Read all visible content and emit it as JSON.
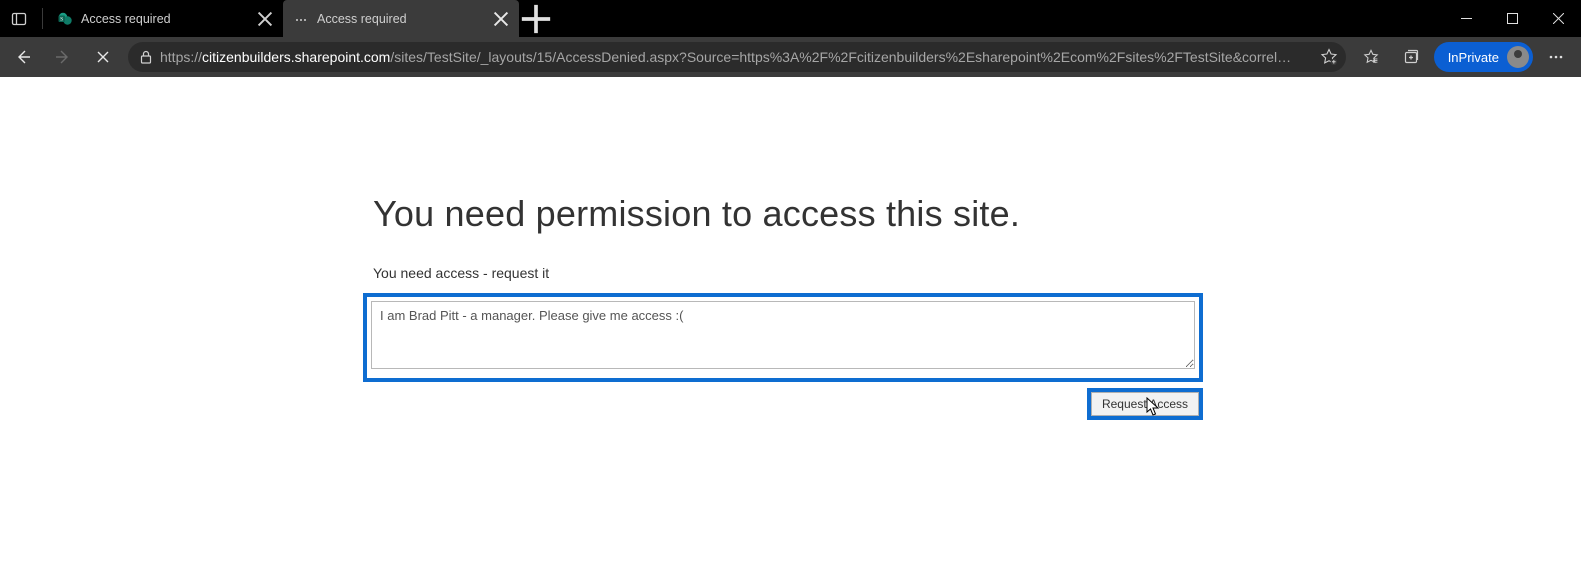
{
  "window": {
    "tabs": [
      {
        "title": "Access required",
        "favicon": "sharepoint",
        "active": false
      },
      {
        "title": "Access required",
        "favicon": "generic",
        "active": true
      }
    ],
    "url_protocol": "https://",
    "url_host": "citizenbuilders.sharepoint.com",
    "url_path": "/sites/TestSite/_layouts/15/AccessDenied.aspx?Source=https%3A%2F%2Fcitizenbuilders%2Esharepoint%2Ecom%2Fsites%2FTestSite&correl…",
    "inprivate_label": "InPrivate"
  },
  "page": {
    "heading": "You need permission to access this site.",
    "subtext": "You need access - request it",
    "message_value": "I am Brad Pitt - a manager. Please give me access :(",
    "request_button": "Request Access"
  }
}
